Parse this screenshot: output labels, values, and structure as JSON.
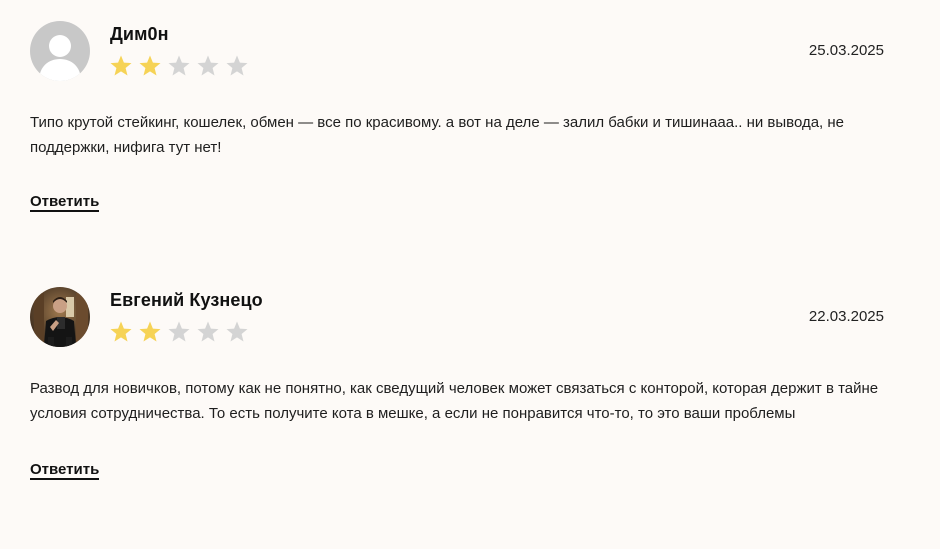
{
  "colors": {
    "background": "#fdfaf7",
    "star_filled": "#f6d356",
    "star_empty": "#d4d4d4",
    "text": "#1e1e1e"
  },
  "reviews": [
    {
      "author": "Дим0н",
      "avatar_icon": "default-user-avatar",
      "rating": 2,
      "rating_max": 5,
      "date": "25.03.2025",
      "text": "Типо крутой стейкинг, кошелек, обмен — все по красивому. а вот на деле — залил бабки и тишинааа.. ни вывода, не поддержки, нифига тут нет!",
      "reply_label": "Ответить"
    },
    {
      "author": "Евгений Кузнецо",
      "avatar_icon": "user-photo-avatar",
      "rating": 2,
      "rating_max": 5,
      "date": "22.03.2025",
      "text": "Развод для новичков, потому как не понятно, как сведущий человек может связаться с конторой, которая держит в тайне условия сотрудничества. То есть получите кота в мешке, а если не понравится что-то, то это ваши проблемы",
      "reply_label": "Ответить"
    }
  ]
}
